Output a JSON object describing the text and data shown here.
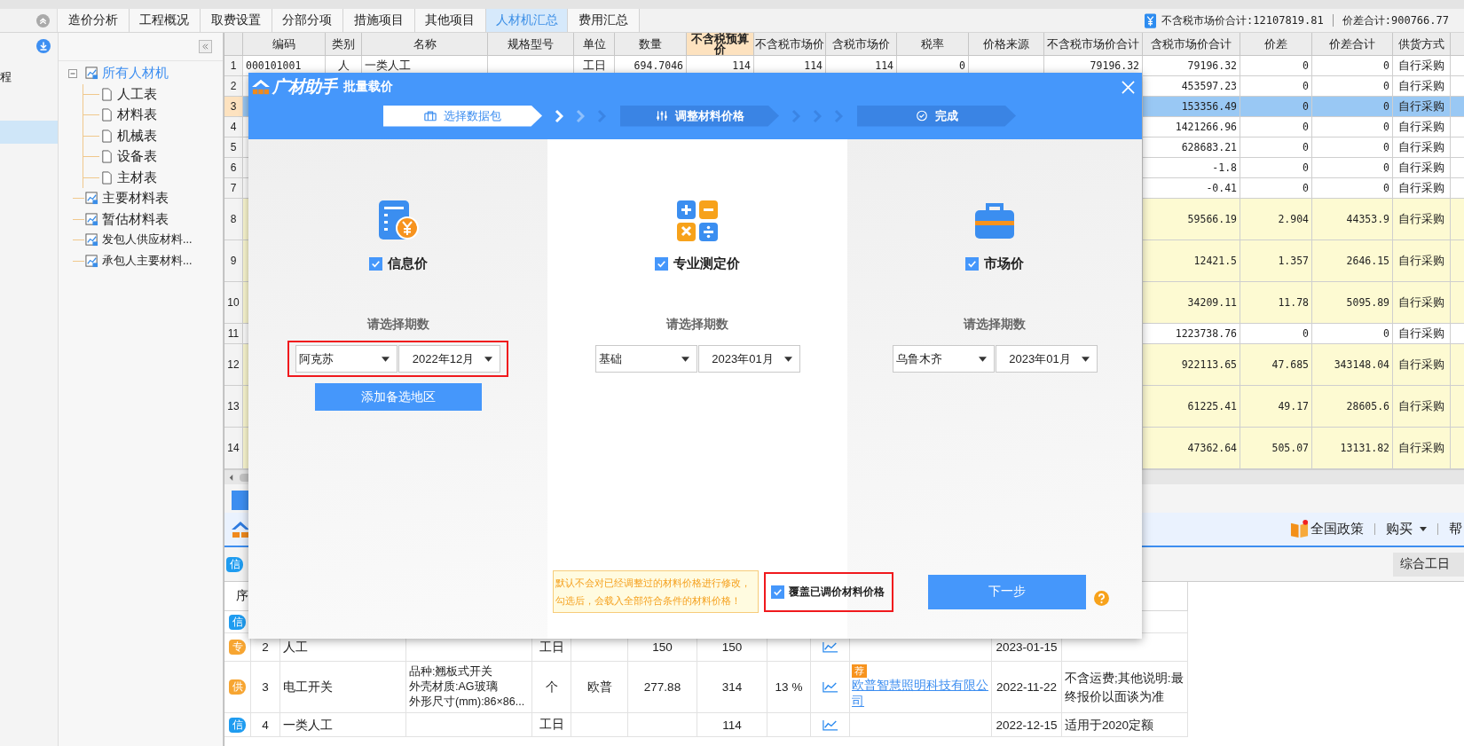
{
  "tabs": [
    {
      "label": "造价分析",
      "selected": false
    },
    {
      "label": "工程概况",
      "selected": false
    },
    {
      "label": "取费设置",
      "selected": false
    },
    {
      "label": "分部分项",
      "selected": false
    },
    {
      "label": "措施项目",
      "selected": false
    },
    {
      "label": "其他项目",
      "selected": false
    },
    {
      "label": "人材机汇总",
      "selected": true
    },
    {
      "label": "费用汇总",
      "selected": false
    }
  ],
  "summary": [
    "不含税市场价合计:12107819.81",
    "价差合计:900766.77"
  ],
  "side_panel": {
    "items": [
      {
        "label": "程",
        "selected": false
      },
      {
        "selected": true
      }
    ]
  },
  "tree": {
    "items": [
      {
        "label": "所有人材机",
        "kind": "group",
        "selected": true,
        "expanded": true,
        "children": [
          {
            "label": "人工表",
            "kind": "sheet",
            "selected": false
          },
          {
            "label": "材料表",
            "kind": "sheet",
            "selected": false
          },
          {
            "label": "机械表",
            "kind": "sheet",
            "selected": false
          },
          {
            "label": "设备表",
            "kind": "sheet",
            "selected": false
          },
          {
            "label": "主材表",
            "kind": "sheet",
            "selected": false
          }
        ]
      },
      {
        "label": "主要材料表",
        "kind": "group",
        "selected": false
      },
      {
        "label": "暂估材料表",
        "kind": "group",
        "selected": false
      },
      {
        "label": "发包人供应材料...",
        "kind": "group",
        "selected": false
      },
      {
        "label": "承包人主要材料...",
        "kind": "group",
        "selected": false
      }
    ]
  },
  "table": {
    "columns": [
      {
        "label": "编码",
        "selected": false
      },
      {
        "label": "类别",
        "selected": false
      },
      {
        "label": "名称",
        "selected": false
      },
      {
        "label": "规格型号",
        "selected": false
      },
      {
        "label": "单位",
        "selected": false
      },
      {
        "label": "数量",
        "selected": false
      },
      {
        "label": "不含税预算价",
        "selected": true
      },
      {
        "label": "不含税市场价",
        "selected": false
      },
      {
        "label": "含税市场价",
        "selected": false
      },
      {
        "label": "税率",
        "selected": false
      },
      {
        "label": "价格来源",
        "selected": false
      },
      {
        "label": "不含税市场价合计",
        "selected": false
      },
      {
        "label": "含税市场价合计",
        "selected": false
      },
      {
        "label": "价差",
        "selected": false
      },
      {
        "label": "价差合计",
        "selected": false
      },
      {
        "label": "供货方式",
        "selected": false
      }
    ],
    "rows": [
      {
        "no": "1",
        "selected": false,
        "highlighted": false,
        "code": "000101001",
        "type": "人",
        "name": "一类人工",
        "unit": "工日",
        "qty": "694.7046",
        "budget": "114",
        "market": "114",
        "market_tax": "114",
        "tax": "0",
        "total": "79196.32",
        "total_tax": "79196.32",
        "diff": "0",
        "diff_total": "0",
        "supply": "自行采购"
      },
      {
        "no": "2",
        "selected": false,
        "highlighted": false,
        "total_tax": "453597.23",
        "diff": "0",
        "diff_total": "0",
        "supply": "自行采购"
      },
      {
        "no": "3",
        "selected": true,
        "highlighted": false,
        "total_tax": "153356.49",
        "diff": "0",
        "diff_total": "0",
        "supply": "自行采购"
      },
      {
        "no": "4",
        "selected": false,
        "highlighted": false,
        "total_tax": "1421266.96",
        "diff": "0",
        "diff_total": "0",
        "supply": "自行采购"
      },
      {
        "no": "5",
        "selected": false,
        "highlighted": false,
        "total_tax": "628683.21",
        "diff": "0",
        "diff_total": "0",
        "supply": "自行采购"
      },
      {
        "no": "6",
        "selected": false,
        "highlighted": false,
        "total_tax": "-1.8",
        "diff": "0",
        "diff_total": "0",
        "supply": "自行采购"
      },
      {
        "no": "7",
        "selected": false,
        "highlighted": false,
        "total_tax": "-0.41",
        "diff": "0",
        "diff_total": "0",
        "supply": "自行采购"
      },
      {
        "no": "8",
        "selected": false,
        "highlighted": true,
        "total_tax": "59566.19",
        "diff": "2.904",
        "diff_total": "44353.9",
        "supply": "自行采购"
      },
      {
        "no": "9",
        "selected": false,
        "highlighted": true,
        "total_tax": "12421.5",
        "diff": "1.357",
        "diff_total": "2646.15",
        "supply": "自行采购"
      },
      {
        "no": "10",
        "selected": false,
        "highlighted": true,
        "total_tax": "34209.11",
        "diff": "11.78",
        "diff_total": "5095.89",
        "supply": "自行采购"
      },
      {
        "no": "11",
        "selected": false,
        "highlighted": false,
        "total_tax": "1223738.76",
        "diff": "0",
        "diff_total": "0",
        "supply": "自行采购"
      },
      {
        "no": "12",
        "selected": false,
        "highlighted": true,
        "total_tax": "922113.65",
        "diff": "47.685",
        "diff_total": "343148.04",
        "supply": "自行采购"
      },
      {
        "no": "13",
        "selected": false,
        "highlighted": true,
        "total_tax": "61225.41",
        "diff": "49.17",
        "diff_total": "28605.6",
        "supply": "自行采购"
      },
      {
        "no": "14",
        "selected": false,
        "highlighted": true,
        "total_tax": "47362.64",
        "diff": "505.07",
        "diff_total": "13131.82",
        "supply": "自行采购"
      }
    ]
  },
  "lower_panel": {
    "toolbar": [
      {
        "label": "全国政策",
        "kind": "policy"
      },
      {
        "label": "购买",
        "kind": "menu"
      },
      {
        "label": "帮",
        "kind": "plain"
      }
    ],
    "filter": {
      "badge": "信",
      "color": "#1f9cf0",
      "value": "综合工日"
    },
    "header_first": "序",
    "rows": [
      {
        "badge": "信",
        "color": "#1f9cf0"
      },
      {
        "badge": "专",
        "color": "#f7a531",
        "no": "2",
        "name": "人工",
        "unit": "工日",
        "price": "150",
        "market": "150",
        "date": "2023-01-15"
      },
      {
        "badge": "供",
        "color": "#f7a531",
        "no": "3",
        "name": "电工开关",
        "spec": [
          "品种:翘板式开关",
          "外壳材质:AG玻璃",
          "外形尺寸(mm):86×86..."
        ],
        "unit": "个",
        "brand": "欧普",
        "price": "277.88",
        "market": "314",
        "tax": "13 %",
        "tag": "荐",
        "supplier": "欧普智慧照明科技有限公司",
        "date": "2022-11-22",
        "note": "不含运费;其他说明:最终报价以面谈为准"
      },
      {
        "badge": "信",
        "color": "#1f9cf0",
        "no": "4",
        "name": "一类人工",
        "unit": "工日",
        "market": "114",
        "date": "2022-12-15",
        "note": "适用于2020定额"
      }
    ]
  },
  "modal": {
    "brand": "广材助手",
    "title": "批量载价",
    "steps": [
      {
        "label": "选择数据包",
        "kind": "package",
        "selected": true
      },
      {
        "label": "调整材料价格",
        "kind": "adjust",
        "selected": false
      },
      {
        "label": "完成",
        "kind": "done",
        "selected": false
      }
    ],
    "sources": [
      {
        "kind": "info",
        "label": "信息价",
        "checked": true,
        "period_label": "请选择期数",
        "region": "阿克苏",
        "period": "2022年12月",
        "highlighted": true,
        "add_button": "添加备选地区"
      },
      {
        "kind": "calc",
        "label": "专业测定价",
        "checked": true,
        "period_label": "请选择期数",
        "region": "基础",
        "period": "2023年01月",
        "highlighted": false
      },
      {
        "kind": "market",
        "label": "市场价",
        "checked": true,
        "period_label": "请选择期数",
        "region": "乌鲁木齐",
        "period": "2023年01月",
        "highlighted": false
      }
    ],
    "notice": [
      "默认不会对已经调整过的材料价格进行修改，",
      "勾选后，会载入全部符合条件的材料价格！"
    ],
    "overwrite": {
      "label": "覆盖已调价材料价格",
      "checked": true,
      "highlighted": true
    },
    "next_button": "下一步"
  }
}
